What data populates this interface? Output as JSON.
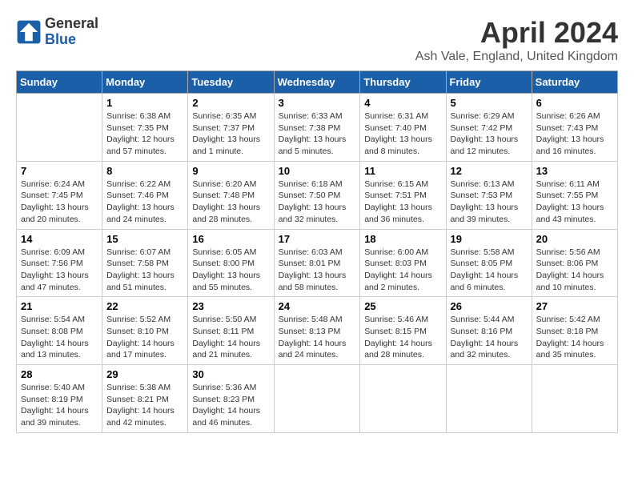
{
  "logo": {
    "general": "General",
    "blue": "Blue"
  },
  "title": "April 2024",
  "location": "Ash Vale, England, United Kingdom",
  "days_of_week": [
    "Sunday",
    "Monday",
    "Tuesday",
    "Wednesday",
    "Thursday",
    "Friday",
    "Saturday"
  ],
  "weeks": [
    [
      {
        "day": "",
        "content": ""
      },
      {
        "day": "1",
        "content": "Sunrise: 6:38 AM\nSunset: 7:35 PM\nDaylight: 12 hours\nand 57 minutes."
      },
      {
        "day": "2",
        "content": "Sunrise: 6:35 AM\nSunset: 7:37 PM\nDaylight: 13 hours\nand 1 minute."
      },
      {
        "day": "3",
        "content": "Sunrise: 6:33 AM\nSunset: 7:38 PM\nDaylight: 13 hours\nand 5 minutes."
      },
      {
        "day": "4",
        "content": "Sunrise: 6:31 AM\nSunset: 7:40 PM\nDaylight: 13 hours\nand 8 minutes."
      },
      {
        "day": "5",
        "content": "Sunrise: 6:29 AM\nSunset: 7:42 PM\nDaylight: 13 hours\nand 12 minutes."
      },
      {
        "day": "6",
        "content": "Sunrise: 6:26 AM\nSunset: 7:43 PM\nDaylight: 13 hours\nand 16 minutes."
      }
    ],
    [
      {
        "day": "7",
        "content": "Sunrise: 6:24 AM\nSunset: 7:45 PM\nDaylight: 13 hours\nand 20 minutes."
      },
      {
        "day": "8",
        "content": "Sunrise: 6:22 AM\nSunset: 7:46 PM\nDaylight: 13 hours\nand 24 minutes."
      },
      {
        "day": "9",
        "content": "Sunrise: 6:20 AM\nSunset: 7:48 PM\nDaylight: 13 hours\nand 28 minutes."
      },
      {
        "day": "10",
        "content": "Sunrise: 6:18 AM\nSunset: 7:50 PM\nDaylight: 13 hours\nand 32 minutes."
      },
      {
        "day": "11",
        "content": "Sunrise: 6:15 AM\nSunset: 7:51 PM\nDaylight: 13 hours\nand 36 minutes."
      },
      {
        "day": "12",
        "content": "Sunrise: 6:13 AM\nSunset: 7:53 PM\nDaylight: 13 hours\nand 39 minutes."
      },
      {
        "day": "13",
        "content": "Sunrise: 6:11 AM\nSunset: 7:55 PM\nDaylight: 13 hours\nand 43 minutes."
      }
    ],
    [
      {
        "day": "14",
        "content": "Sunrise: 6:09 AM\nSunset: 7:56 PM\nDaylight: 13 hours\nand 47 minutes."
      },
      {
        "day": "15",
        "content": "Sunrise: 6:07 AM\nSunset: 7:58 PM\nDaylight: 13 hours\nand 51 minutes."
      },
      {
        "day": "16",
        "content": "Sunrise: 6:05 AM\nSunset: 8:00 PM\nDaylight: 13 hours\nand 55 minutes."
      },
      {
        "day": "17",
        "content": "Sunrise: 6:03 AM\nSunset: 8:01 PM\nDaylight: 13 hours\nand 58 minutes."
      },
      {
        "day": "18",
        "content": "Sunrise: 6:00 AM\nSunset: 8:03 PM\nDaylight: 14 hours\nand 2 minutes."
      },
      {
        "day": "19",
        "content": "Sunrise: 5:58 AM\nSunset: 8:05 PM\nDaylight: 14 hours\nand 6 minutes."
      },
      {
        "day": "20",
        "content": "Sunrise: 5:56 AM\nSunset: 8:06 PM\nDaylight: 14 hours\nand 10 minutes."
      }
    ],
    [
      {
        "day": "21",
        "content": "Sunrise: 5:54 AM\nSunset: 8:08 PM\nDaylight: 14 hours\nand 13 minutes."
      },
      {
        "day": "22",
        "content": "Sunrise: 5:52 AM\nSunset: 8:10 PM\nDaylight: 14 hours\nand 17 minutes."
      },
      {
        "day": "23",
        "content": "Sunrise: 5:50 AM\nSunset: 8:11 PM\nDaylight: 14 hours\nand 21 minutes."
      },
      {
        "day": "24",
        "content": "Sunrise: 5:48 AM\nSunset: 8:13 PM\nDaylight: 14 hours\nand 24 minutes."
      },
      {
        "day": "25",
        "content": "Sunrise: 5:46 AM\nSunset: 8:15 PM\nDaylight: 14 hours\nand 28 minutes."
      },
      {
        "day": "26",
        "content": "Sunrise: 5:44 AM\nSunset: 8:16 PM\nDaylight: 14 hours\nand 32 minutes."
      },
      {
        "day": "27",
        "content": "Sunrise: 5:42 AM\nSunset: 8:18 PM\nDaylight: 14 hours\nand 35 minutes."
      }
    ],
    [
      {
        "day": "28",
        "content": "Sunrise: 5:40 AM\nSunset: 8:19 PM\nDaylight: 14 hours\nand 39 minutes."
      },
      {
        "day": "29",
        "content": "Sunrise: 5:38 AM\nSunset: 8:21 PM\nDaylight: 14 hours\nand 42 minutes."
      },
      {
        "day": "30",
        "content": "Sunrise: 5:36 AM\nSunset: 8:23 PM\nDaylight: 14 hours\nand 46 minutes."
      },
      {
        "day": "",
        "content": ""
      },
      {
        "day": "",
        "content": ""
      },
      {
        "day": "",
        "content": ""
      },
      {
        "day": "",
        "content": ""
      }
    ]
  ]
}
